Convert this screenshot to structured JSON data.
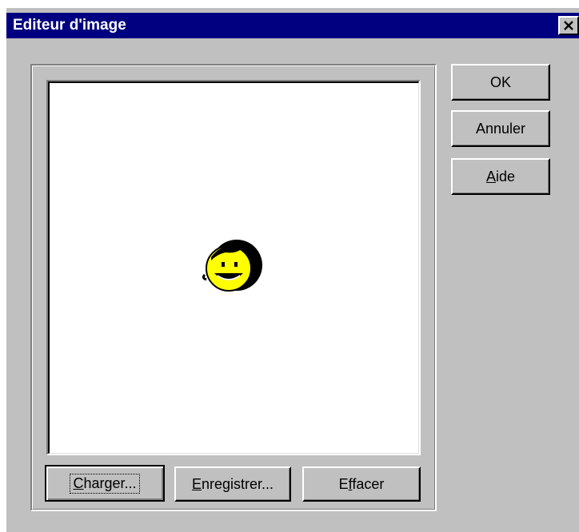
{
  "window": {
    "title": "Editeur d'image",
    "close_glyph": "✕"
  },
  "buttons": {
    "ok": "OK",
    "cancel": "Annuler",
    "help_prefix": "A",
    "help_rest": "ide",
    "load_prefix": "C",
    "load_rest": "harger...",
    "save_prefix": "E",
    "save_rest": "nregistrer...",
    "clear_pre": "E",
    "clear_ul": "f",
    "clear_rest": "facer"
  },
  "canvas": {
    "image_icon": "smiley-face-icon"
  },
  "colors": {
    "titlebar": "#000080",
    "face": "#ffff00",
    "dialog": "#c0c0c0"
  }
}
